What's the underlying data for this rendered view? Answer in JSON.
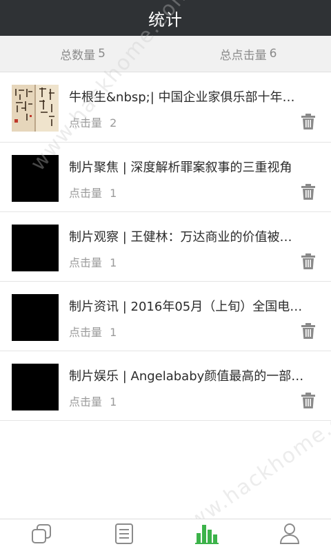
{
  "header": {
    "title": "统计"
  },
  "stats": {
    "total_count_label": "总数量",
    "total_count_value": "5",
    "total_clicks_label": "总点击量",
    "total_clicks_value": "6"
  },
  "items": [
    {
      "title": "牛根生&nbsp;| 中国企业家俱乐部十年…",
      "clicks_label": "点击量",
      "clicks_value": "2",
      "thumbnail": "calligraphy"
    },
    {
      "title": "制片聚焦 | 深度解析罪案叙事的三重视角",
      "clicks_label": "点击量",
      "clicks_value": "1",
      "thumbnail": "black"
    },
    {
      "title": "制片观察 | 王健林：万达商业的价值被…",
      "clicks_label": "点击量",
      "clicks_value": "1",
      "thumbnail": "black"
    },
    {
      "title": "制片资讯 | 2016年05月（上旬）全国电…",
      "clicks_label": "点击量",
      "clicks_value": "1",
      "thumbnail": "black"
    },
    {
      "title": "制片娱乐 | Angelababy颜值最高的一部…",
      "clicks_label": "点击量",
      "clicks_value": "1",
      "thumbnail": "black"
    }
  ],
  "tabbar": {
    "tabs": [
      {
        "icon": "overlapping-squares-icon",
        "active": false
      },
      {
        "icon": "document-list-icon",
        "active": false
      },
      {
        "icon": "bar-chart-icon",
        "active": true
      },
      {
        "icon": "user-icon",
        "active": false
      }
    ]
  },
  "watermark": "www.hackhome.com",
  "colors": {
    "header_bg": "#2f3235",
    "active_tab": "#3cb34a",
    "inactive_tab": "#8a8a8a",
    "delete_icon": "#8a8a8a"
  }
}
